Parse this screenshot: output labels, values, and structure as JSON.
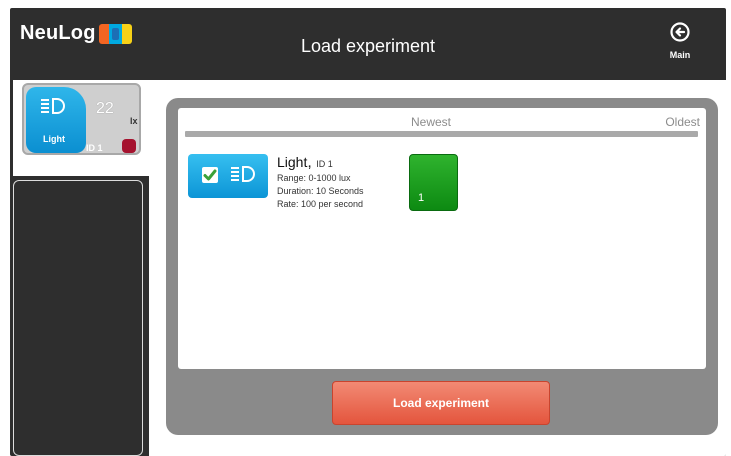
{
  "app": {
    "logo_text": "NeuLog"
  },
  "header": {
    "title": "Load experiment",
    "main_label": "Main"
  },
  "sensor": {
    "name": "Light",
    "value": "22",
    "unit": "lx",
    "id_label": "ID 1",
    "icon": "light-sensor-icon"
  },
  "experiment_list": {
    "header_newest": "Newest",
    "header_oldest": "Oldest",
    "experiments": [
      {
        "title": "Light",
        "id_label": "ID 1",
        "range": "Range: 0-1000 lux",
        "duration": "Duration: 10 Seconds",
        "rate": "Rate: 100 per second",
        "runs": [
          "1"
        ],
        "selected": true
      }
    ]
  },
  "actions": {
    "load_label": "Load experiment"
  },
  "colors": {
    "background_dark": "#2e2e2e",
    "sensor_blue": "#0b8fd1",
    "run_green": "#1ea520",
    "load_button": "#e4553d",
    "led_red": "#a5122e"
  }
}
